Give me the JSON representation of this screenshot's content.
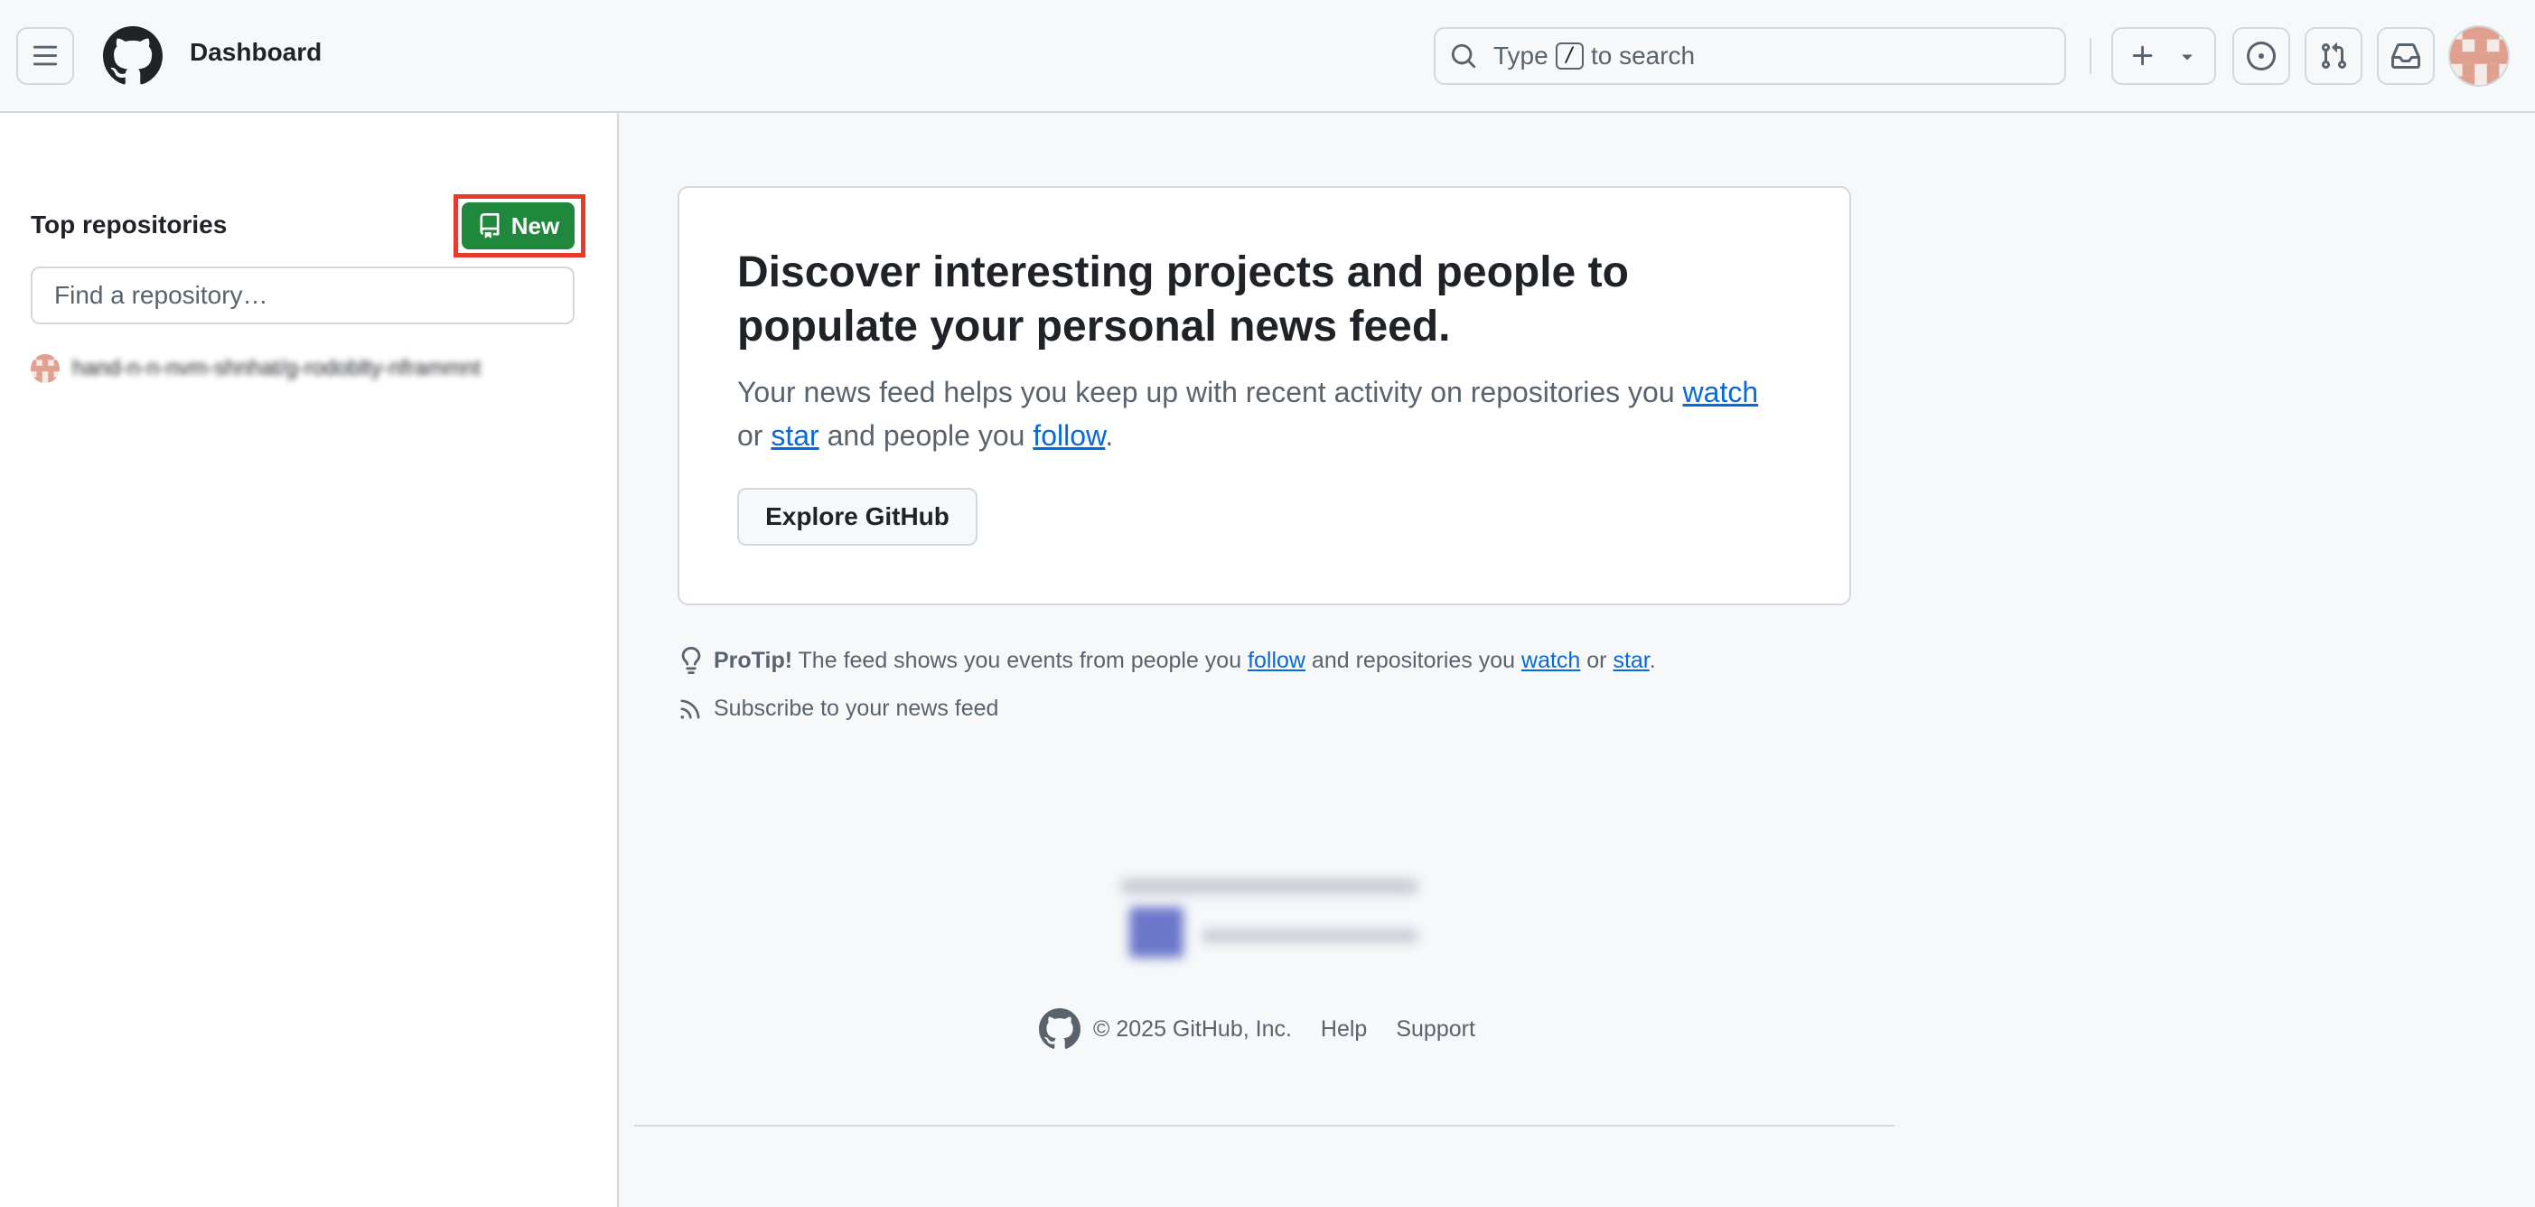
{
  "header": {
    "context_title": "Dashboard",
    "search": {
      "prefix": "Type",
      "shortcut": "/",
      "suffix": "to search"
    },
    "icons": [
      "menu-icon",
      "github-logo-icon",
      "search-icon",
      "plus-icon",
      "triangle-down-icon",
      "issue-opened-icon",
      "git-pull-request-icon",
      "inbox-icon"
    ]
  },
  "sidebar": {
    "title": "Top repositories",
    "new_button": "New",
    "find_placeholder": "Find a repository…",
    "repos": [
      {
        "name": "hand-n-n-nvm-shnhat/g-rodoblty-nframmnt"
      }
    ]
  },
  "feed_card": {
    "title": "Discover interesting projects and people to populate your personal news feed.",
    "desc_1": "Your news feed helps you keep up with recent activity on repositories you ",
    "watch": "watch",
    "desc_2": " or ",
    "star": "star",
    "desc_3": " and people you ",
    "follow": "follow",
    "desc_4": ".",
    "explore_button": "Explore GitHub"
  },
  "protip": {
    "label": "ProTip!",
    "text_1": " The feed shows you events from people you ",
    "follow": "follow",
    "text_2": " and repositories you ",
    "watch": "watch",
    "text_3": " or ",
    "star": "star",
    "text_4": "."
  },
  "subscribe": "Subscribe to your news feed",
  "footer": {
    "copyright": "© 2025 GitHub, Inc.",
    "links": [
      "Help",
      "Support"
    ]
  },
  "colors": {
    "accent_link": "#0969da",
    "primary_button": "#1f883d",
    "highlight_box": "#e8392d",
    "border": "#d1d9e0",
    "muted_text": "#59636e"
  }
}
